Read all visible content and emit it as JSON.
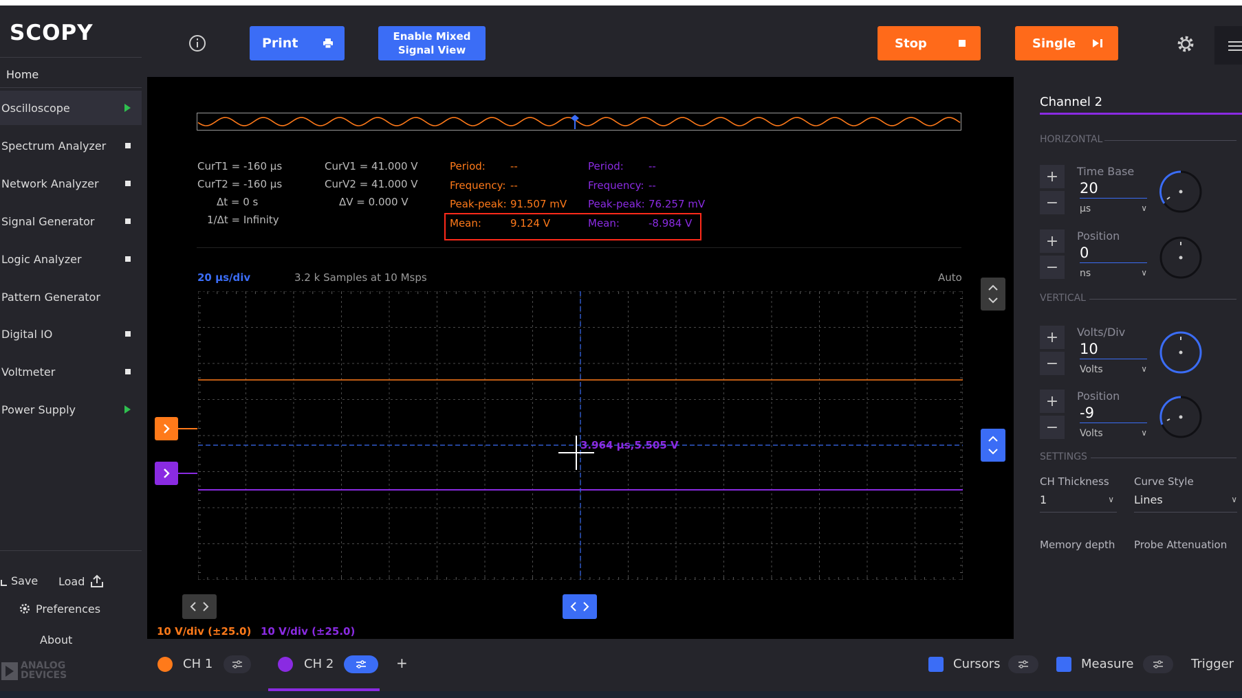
{
  "app": {
    "logo": "SCOPY"
  },
  "sidebar": {
    "home": "Home",
    "tools": [
      {
        "label": "Oscilloscope",
        "status": "play"
      },
      {
        "label": "Spectrum Analyzer",
        "status": "stop"
      },
      {
        "label": "Network Analyzer",
        "status": "stop"
      },
      {
        "label": "Signal Generator",
        "status": "stop"
      },
      {
        "label": "Logic Analyzer",
        "status": "stop"
      },
      {
        "label": "Pattern Generator",
        "status": "none"
      },
      {
        "label": "Digital IO",
        "status": "stop"
      },
      {
        "label": "Voltmeter",
        "status": "stop"
      },
      {
        "label": "Power Supply",
        "status": "play"
      }
    ],
    "save": "Save",
    "load": "Load",
    "preferences": "Preferences",
    "about": "About",
    "vendor": [
      "ANALOG",
      "DEVICES"
    ]
  },
  "toolbar": {
    "print": "Print",
    "mixed_line1": "Enable Mixed",
    "mixed_line2": "Signal View",
    "stop": "Stop",
    "single": "Single"
  },
  "cursors": {
    "curt1": "CurT1 = -160 µs",
    "curt2": "CurT2 = -160 µs",
    "dt": "Δt = 0 s",
    "inv_dt": "1/Δt = Infinity",
    "curv1": "CurV1 = 41.000 V",
    "curv2": "CurV2 = 41.000 V",
    "dv": "ΔV =  0.000 V"
  },
  "measure": {
    "ch1": {
      "period_label": "Period:",
      "period": "--",
      "freq_label": "Frequency:",
      "freq": "--",
      "pp_label": "Peak-peak:",
      "pp": "91.507 mV",
      "mean_label": "Mean:",
      "mean": "9.124 V"
    },
    "ch2": {
      "period_label": "Period:",
      "period": "--",
      "freq_label": "Frequency:",
      "freq": "--",
      "pp_label": "Peak-peak:",
      "pp": "76.257 mV",
      "mean_label": "Mean:",
      "mean": "-8.984 V"
    }
  },
  "plot": {
    "timebase": "20 µs/div",
    "samples": "3.2 k Samples at 10 Msps",
    "mode": "Auto",
    "marker": "3.964 µs,5.505 V",
    "ch1_scale": "10 V/div (±25.0)",
    "ch2_scale": "10 V/div (±25.0)"
  },
  "panel": {
    "title": "Channel 2",
    "horizontal": "HORIZONTAL",
    "time_base_label": "Time Base",
    "time_base_value": "20",
    "time_base_unit": "µs",
    "h_position_label": "Position",
    "h_position_value": "0",
    "h_position_unit": "ns",
    "vertical": "VERTICAL",
    "volts_div_label": "Volts/Div",
    "volts_div_value": "10",
    "volts_div_unit": "Volts",
    "v_position_label": "Position",
    "v_position_value": "-9",
    "v_position_unit": "Volts",
    "settings": "SETTINGS",
    "thickness_label": "CH Thickness",
    "thickness_value": "1",
    "curve_style_label": "Curve Style",
    "curve_style_value": "Lines",
    "memory_label": "Memory depth",
    "probe_label": "Probe Attenuation"
  },
  "bottom": {
    "ch1": "CH 1",
    "ch2": "CH 2",
    "add": "+",
    "cursors": "Cursors",
    "measure": "Measure",
    "trigger": "Trigger"
  },
  "colors": {
    "ch1": "#ff7a1a",
    "ch2": "#8a2be2",
    "accent": "#3b6df6",
    "stop_button": "#ff6a1a",
    "highlight_box": "#ff2a1a"
  }
}
